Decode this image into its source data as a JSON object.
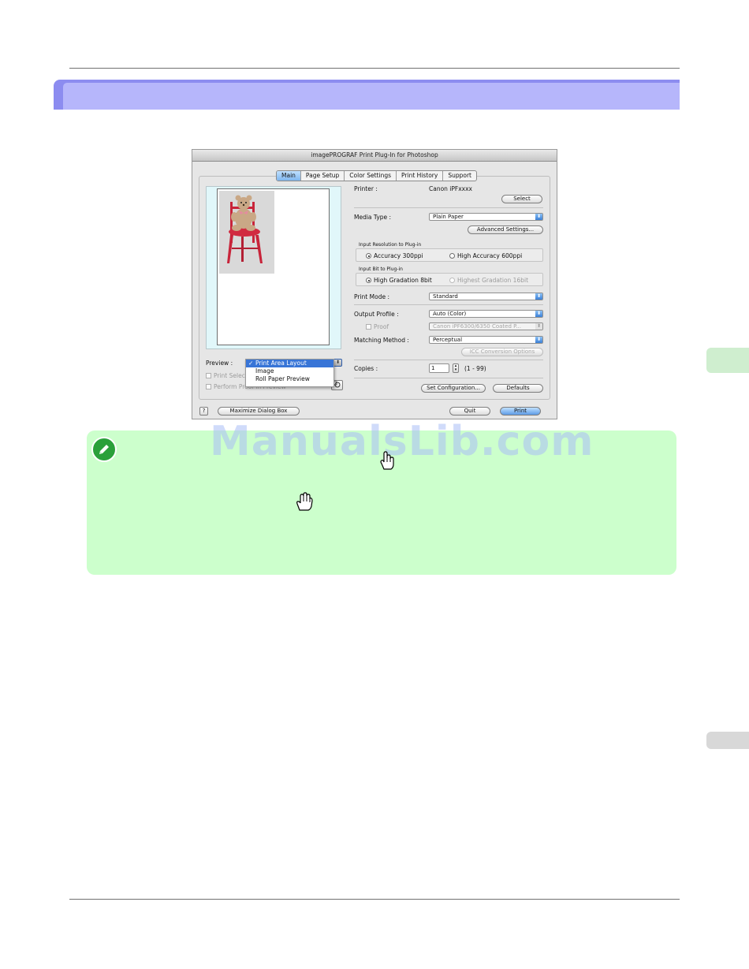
{
  "dialog": {
    "title": "imagePROGRAF Print Plug-In for Photoshop",
    "tabs": [
      "Main",
      "Page Setup",
      "Color Settings",
      "Print History",
      "Support"
    ],
    "printer_label": "Printer :",
    "printer_value": "Canon iPFxxxx",
    "select_button": "Select",
    "media_type_label": "Media Type :",
    "media_type_value": "Plain Paper",
    "advanced_button": "Advanced Settings...",
    "input_resolution_label": "Input Resolution to Plug-in",
    "res_option_1": "Accuracy 300ppi",
    "res_option_2": "High Accuracy 600ppi",
    "input_bit_label": "Input Bit to Plug-in",
    "bit_option_1": "High Gradation 8bit",
    "bit_option_2": "Highest Gradation 16bit",
    "print_mode_label": "Print Mode :",
    "print_mode_value": "Standard",
    "output_profile_label": "Output Profile :",
    "output_profile_value": "Auto (Color)",
    "proof_label": "Proof",
    "proof_value": "Canon iPF6300/6350 Coated P...",
    "matching_label": "Matching Method :",
    "matching_value": "Perceptual",
    "icc_button": "ICC Conversion Options",
    "preview_label": "Preview :",
    "preview_options": [
      "Print Area Layout",
      "Image",
      "Roll Paper Preview"
    ],
    "preview_check_mark": "✓",
    "print_selected_label": "Print Selecte",
    "perform_proof_label": "Perform Proof in Preview",
    "copies_label": "Copies :",
    "copies_value": "1",
    "copies_range": "(1 - 99)",
    "set_config_button": "Set Configuration...",
    "defaults_button": "Defaults",
    "help_glyph": "?",
    "maximize_button": "Maximize Dialog Box",
    "quit_button": "Quit",
    "print_button": "Print"
  },
  "watermark": "ManualsLib.com",
  "colors": {
    "section_bar": "#b6b6fb",
    "note_bg": "#ccffcc",
    "side_tab": "#cfeecf"
  }
}
